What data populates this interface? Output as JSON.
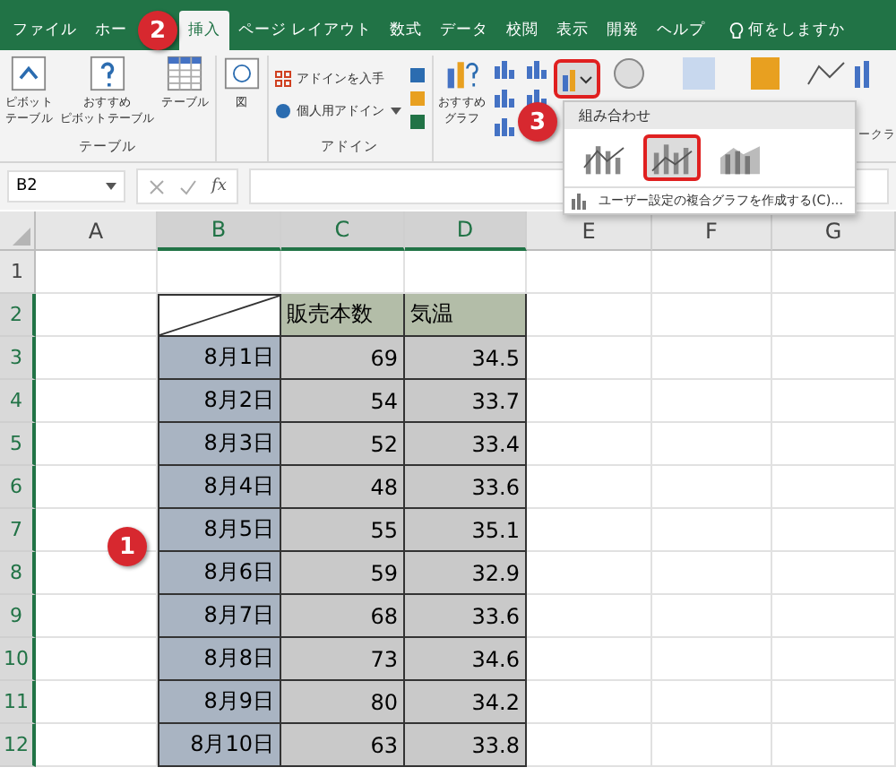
{
  "tabs": [
    {
      "label": "ファイル",
      "selected": false
    },
    {
      "label": "ホー",
      "selected": false
    },
    {
      "label": "挿入",
      "selected": true
    },
    {
      "label": "ページ レイアウト",
      "selected": false
    },
    {
      "label": "数式",
      "selected": false
    },
    {
      "label": "データ",
      "selected": false
    },
    {
      "label": "校閲",
      "selected": false
    },
    {
      "label": "表示",
      "selected": false
    },
    {
      "label": "開発",
      "selected": false
    },
    {
      "label": "ヘルプ",
      "selected": false
    }
  ],
  "tell_me": "何をしますか",
  "ribbon": {
    "table_group": {
      "label": "テーブル",
      "buttons": [
        [
          "ピボット",
          "テーブル"
        ],
        [
          "おすすめ",
          "ピボットテーブル"
        ],
        [
          "テーブル"
        ]
      ]
    },
    "picture_button": "図",
    "addin_group": {
      "label": "アドイン",
      "buttons": [
        "アドインを入手",
        "個人用アドイン"
      ]
    },
    "chart_group": {
      "recommended": [
        "おすすめ",
        "グラフ"
      ],
      "combo_highlighted": true
    },
    "sparkline_fragment": "ークラ"
  },
  "formula_bar": {
    "name_box": "B2",
    "fx_label": "fx"
  },
  "sheet": {
    "columns": [
      {
        "label": "A",
        "selected": false
      },
      {
        "label": "B",
        "selected": true
      },
      {
        "label": "C",
        "selected": true
      },
      {
        "label": "D",
        "selected": true
      },
      {
        "label": "E",
        "selected": false
      },
      {
        "label": "F",
        "selected": false
      },
      {
        "label": "G",
        "selected": false
      }
    ],
    "rows": [
      {
        "number": "1",
        "selected": false,
        "cells": []
      },
      {
        "number": "2",
        "selected": true,
        "cells": [
          {
            "kind": "empty"
          },
          {
            "kind": "diagonal"
          },
          {
            "kind": "header",
            "text": "販売本数"
          },
          {
            "kind": "header",
            "text": "気温"
          }
        ]
      },
      {
        "number": "3",
        "selected": true,
        "cells": [
          {
            "kind": "empty"
          },
          {
            "kind": "date",
            "text": "8月1日"
          },
          {
            "kind": "number",
            "text": "69"
          },
          {
            "kind": "number",
            "text": "34.5"
          }
        ]
      },
      {
        "number": "4",
        "selected": true,
        "cells": [
          {
            "kind": "empty"
          },
          {
            "kind": "date",
            "text": "8月2日"
          },
          {
            "kind": "number",
            "text": "54"
          },
          {
            "kind": "number",
            "text": "33.7"
          }
        ]
      },
      {
        "number": "5",
        "selected": true,
        "cells": [
          {
            "kind": "empty"
          },
          {
            "kind": "date",
            "text": "8月3日"
          },
          {
            "kind": "number",
            "text": "52"
          },
          {
            "kind": "number",
            "text": "33.4"
          }
        ]
      },
      {
        "number": "6",
        "selected": true,
        "cells": [
          {
            "kind": "empty"
          },
          {
            "kind": "date",
            "text": "8月4日"
          },
          {
            "kind": "number",
            "text": "48"
          },
          {
            "kind": "number",
            "text": "33.6"
          }
        ]
      },
      {
        "number": "7",
        "selected": true,
        "cells": [
          {
            "kind": "empty"
          },
          {
            "kind": "date",
            "text": "8月5日"
          },
          {
            "kind": "number",
            "text": "55"
          },
          {
            "kind": "number",
            "text": "35.1"
          }
        ]
      },
      {
        "number": "8",
        "selected": true,
        "cells": [
          {
            "kind": "empty"
          },
          {
            "kind": "date",
            "text": "8月6日"
          },
          {
            "kind": "number",
            "text": "59"
          },
          {
            "kind": "number",
            "text": "32.9"
          }
        ]
      },
      {
        "number": "9",
        "selected": true,
        "cells": [
          {
            "kind": "empty"
          },
          {
            "kind": "date",
            "text": "8月7日"
          },
          {
            "kind": "number",
            "text": "68"
          },
          {
            "kind": "number",
            "text": "33.6"
          }
        ]
      },
      {
        "number": "10",
        "selected": true,
        "cells": [
          {
            "kind": "empty"
          },
          {
            "kind": "date",
            "text": "8月8日"
          },
          {
            "kind": "number",
            "text": "73"
          },
          {
            "kind": "number",
            "text": "34.6"
          }
        ]
      },
      {
        "number": "11",
        "selected": true,
        "cells": [
          {
            "kind": "empty"
          },
          {
            "kind": "date",
            "text": "8月9日"
          },
          {
            "kind": "number",
            "text": "80"
          },
          {
            "kind": "number",
            "text": "34.2"
          }
        ]
      },
      {
        "number": "12",
        "selected": true,
        "cells": [
          {
            "kind": "empty"
          },
          {
            "kind": "date",
            "text": "8月10日"
          },
          {
            "kind": "number",
            "text": "63"
          },
          {
            "kind": "number",
            "text": "33.8"
          }
        ]
      }
    ]
  },
  "combo_menu": {
    "title": "組み合わせ",
    "options": [
      {
        "selected": false
      },
      {
        "selected": true
      },
      {
        "selected": false
      }
    ],
    "footer": "ユーザー設定の複合グラフを作成する(C)..."
  },
  "callouts": [
    "1",
    "2",
    "3"
  ]
}
